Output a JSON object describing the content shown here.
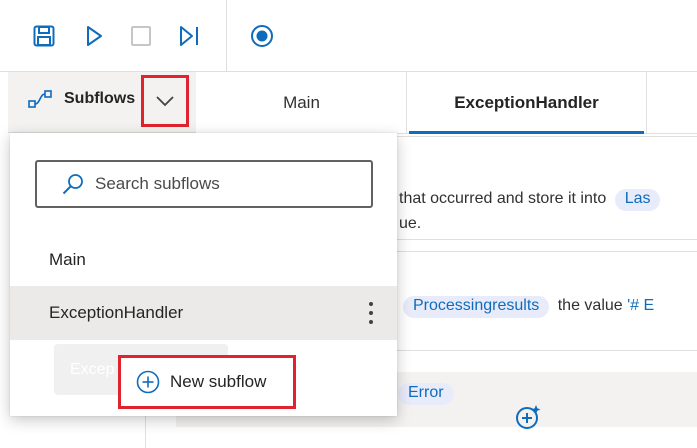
{
  "toolbar": {
    "buttons": [
      "save-icon",
      "run-icon",
      "stop-icon",
      "run-next-action-icon",
      "record-icon"
    ]
  },
  "subflows": {
    "label": "Subflows",
    "search_placeholder": "Search subflows",
    "items": [
      {
        "label": "Main"
      },
      {
        "label": "ExceptionHandler"
      }
    ],
    "ghost_label": "Excep",
    "new_subflow_label": "New subflow"
  },
  "tabs": [
    {
      "label": "Main",
      "active": false
    },
    {
      "label": "ExceptionHandler",
      "active": true
    }
  ],
  "canvas": {
    "action1_text": "that occurred and store it into",
    "action1_token": "Las",
    "action1_line2": "ue.",
    "action2_token": "Processingresults",
    "action2_text": "the value",
    "action2_value": "'# E",
    "action3_token": "Error"
  },
  "colors": {
    "accent": "#0f6cbd",
    "highlight_box": "#e0232e",
    "token_bg": "#e8ebfa"
  }
}
